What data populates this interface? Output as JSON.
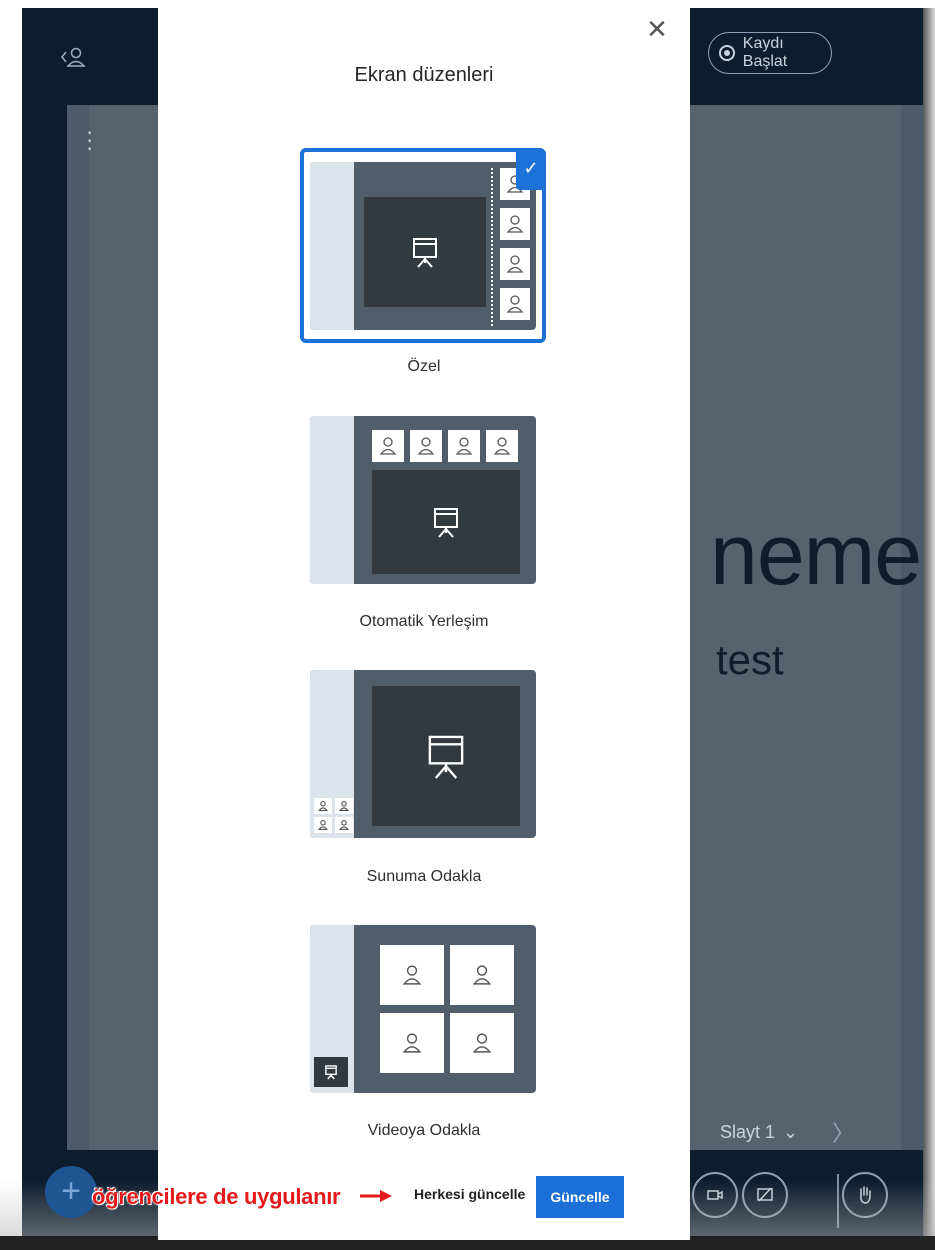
{
  "background": {
    "record_label": "Kaydı Başlat",
    "slide_title": "neme",
    "slide_subtitle": "test",
    "slide_nav_label": "Slayt 1"
  },
  "modal": {
    "title": "Ekran düzenleri",
    "layouts": [
      {
        "label": "Özel",
        "selected": true
      },
      {
        "label": "Otomatik Yerleşim",
        "selected": false
      },
      {
        "label": "Sunuma Odakla",
        "selected": false
      },
      {
        "label": "Videoya Odakla",
        "selected": false
      }
    ],
    "secondary_button": "Herkesi güncelle",
    "primary_button": "Güncelle"
  },
  "annotation": {
    "text": "öğrencilere de uygulanır"
  },
  "colors": {
    "accent": "#1d72d8",
    "annotation": "#e61a1a",
    "app_bg": "#0d1d2e"
  }
}
